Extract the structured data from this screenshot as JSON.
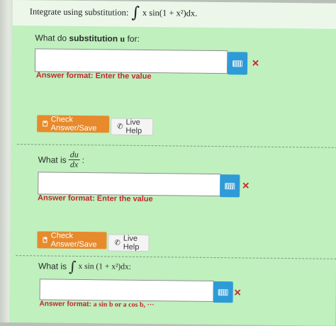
{
  "header": {
    "intro": "Integrate using substitution:",
    "integral_symbol": "∫",
    "expression": "x sin(1 + x²)dx."
  },
  "q1": {
    "prefix": "What do ",
    "bold": "substitution",
    "var": "u",
    "suffix": " for:",
    "input_value": "",
    "format_label": "Answer format: Enter the value"
  },
  "buttons": {
    "check_label": "Check Answer/Save",
    "help_label": "Live Help"
  },
  "q2": {
    "prefix": "What is",
    "frac_num": "du",
    "frac_den": "dx",
    "suffix": ":",
    "input_value": "",
    "format_label": "Answer format: Enter the value"
  },
  "q3": {
    "prefix": "What is",
    "integral_symbol": "∫",
    "expression": "x sin (1 + x²)dx:",
    "input_value": "",
    "format_prefix": "Answer format:",
    "format_example": "a sin b  or  a cos b, ···"
  },
  "icons": {
    "keyboard": "keyboard-icon",
    "clear": "close-icon",
    "save": "save-icon",
    "phone": "phone-icon"
  },
  "colors": {
    "page_bg": "#bff0bd",
    "keyboard_button": "#2e9bd6",
    "check_button": "#e78a2c",
    "error_red": "#c0272d"
  }
}
